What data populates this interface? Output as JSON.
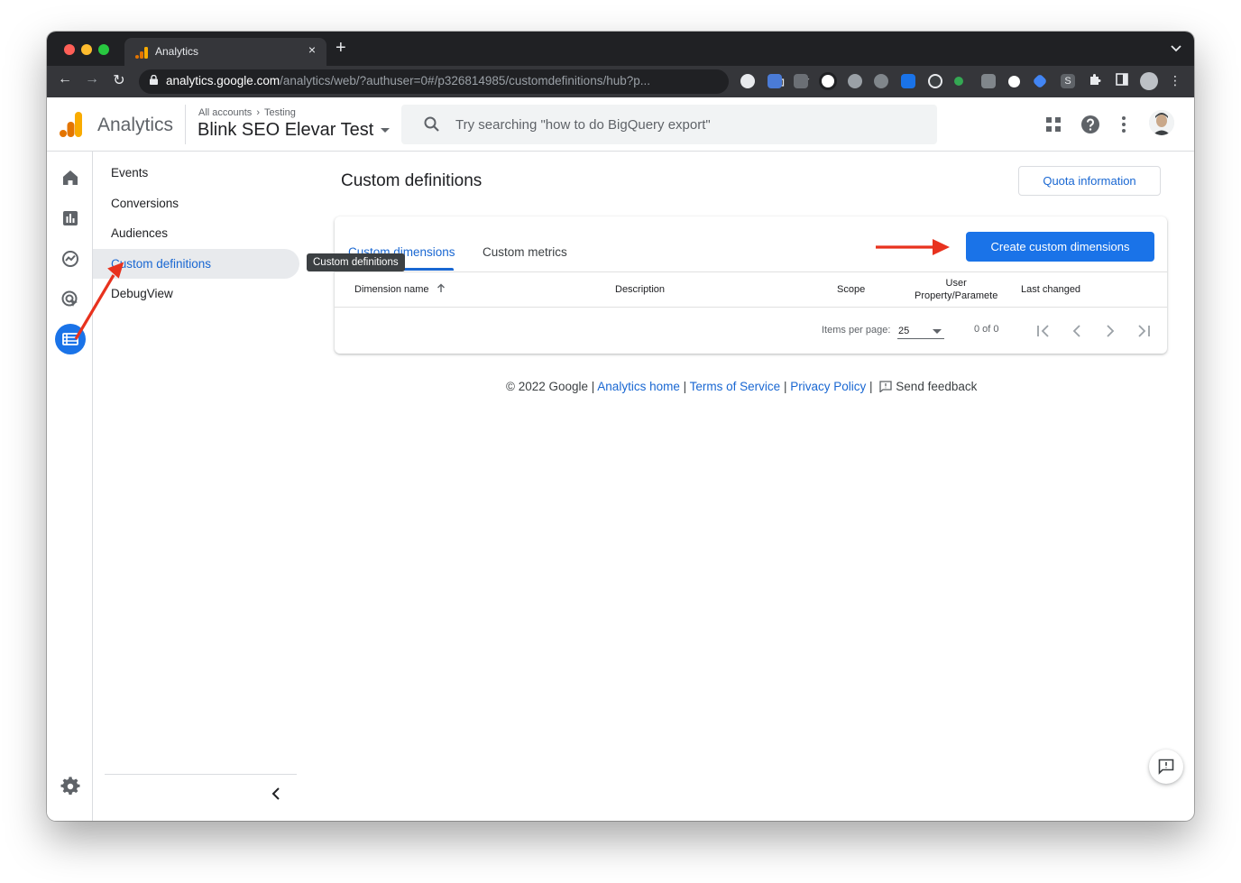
{
  "browser": {
    "tab_title": "Analytics",
    "new_tab": "+",
    "close": "×",
    "url_host": "analytics.google.com",
    "url_path": "/analytics/web/?authuser=0#/p326814985/customdefinitions/hub?p...",
    "back": "←",
    "forward": "→",
    "reload": "↻",
    "star": "☆",
    "menu": "⋮",
    "strip_chevron": "⌄"
  },
  "header": {
    "product": "Analytics",
    "crumb_all": "All accounts",
    "crumb_sep": "›",
    "crumb_account": "Testing",
    "property": "Blink SEO Elevar Test",
    "search_placeholder": "Try searching \"how to do BigQuery export\""
  },
  "subnav": {
    "items": [
      {
        "label": "Events"
      },
      {
        "label": "Conversions"
      },
      {
        "label": "Audiences"
      },
      {
        "label": "Custom definitions"
      },
      {
        "label": "DebugView"
      }
    ],
    "collapse": "‹"
  },
  "tooltip": "Custom definitions",
  "main": {
    "title": "Custom definitions",
    "quota_button": "Quota information",
    "tabs": [
      {
        "label": "Custom dimensions",
        "active": true
      },
      {
        "label": "Custom metrics",
        "active": false
      }
    ],
    "create_button": "Create custom dimensions",
    "columns": {
      "dimension_name": "Dimension name",
      "description": "Description",
      "scope": "Scope",
      "user_property_1": "User",
      "user_property_2": "Property/Paramete",
      "last_changed": "Last changed"
    },
    "pagination": {
      "items_per_page_label": "Items per page:",
      "items_per_page": "25",
      "range": "0 of 0"
    }
  },
  "footer": {
    "copyright": "© 2022 Google |",
    "analytics_home": "Analytics home",
    "sep": "|",
    "terms": "Terms of Service",
    "privacy": "Privacy Policy",
    "feedback": "Send feedback"
  },
  "colors": {
    "accent": "#1a73e8",
    "link": "#1967d2",
    "annotation": "#e8321e"
  }
}
